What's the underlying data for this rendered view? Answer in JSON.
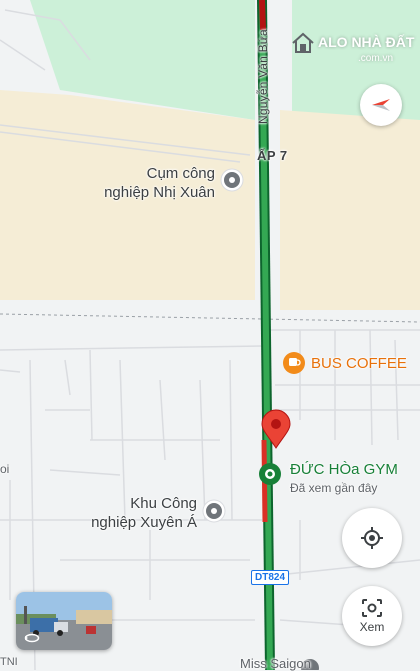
{
  "map": {
    "road_name": "Nguyễn Văn Bứa",
    "hamlet": "ẤP 7",
    "route_shield": "DT824",
    "bottom_partial_label": "Miss Saigon",
    "left_edge_text_1": "oi",
    "left_edge_text_2": "TNI"
  },
  "pois": {
    "industrial_1_line1": "Cụm công",
    "industrial_1_line2": "nghiệp Nhị Xuân",
    "industrial_2_line1": "Khu Công",
    "industrial_2_line2": "nghiệp Xuyên Á",
    "cafe": "BUS COFFEE",
    "gym": "ĐỨC HÒa GYM",
    "gym_subtitle": "Đã xem gần đây"
  },
  "controls": {
    "layers_icon": "compass-icon",
    "location_icon": "my-location-icon",
    "lens_label": "Xem"
  },
  "watermark": {
    "brand": "ALO NHÀ ĐẤT",
    "domain": ".com.vn"
  },
  "colors": {
    "route_green": "#1e8e3e",
    "route_dark": "#0d652d",
    "route_red": "#d93025",
    "park_green": "#ccf0d8",
    "sand": "#f3ead2",
    "pin_red": "#ea4335",
    "cafe_orange": "#f28b1a"
  }
}
